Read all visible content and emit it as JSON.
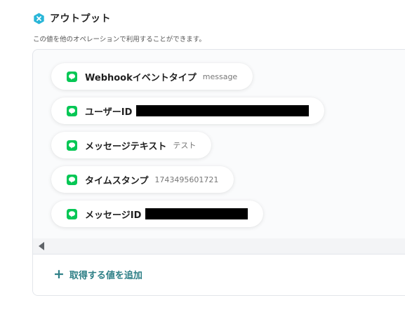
{
  "section": {
    "title": "アウトプット",
    "description": "この値を他のオペレーションで利用することができます。",
    "icon": "x-hexagon-icon",
    "icon_color": "#29b6d8"
  },
  "outputs": [
    {
      "label": "Webhookイベントタイプ",
      "value": "message",
      "icon": "line-app-icon",
      "redacted": false
    },
    {
      "label": "ユーザーID",
      "value": "",
      "icon": "line-app-icon",
      "redacted": true
    },
    {
      "label": "メッセージテキスト",
      "value": "テスト",
      "icon": "line-app-icon",
      "redacted": false
    },
    {
      "label": "タイムスタンプ",
      "value": "1743495601721",
      "icon": "line-app-icon",
      "redacted": false
    },
    {
      "label": "メッセージID",
      "value": "",
      "icon": "line-app-icon",
      "redacted": true
    }
  ],
  "footer": {
    "add_label": "取得する値を追加",
    "add_icon": "plus-icon",
    "accent": "#2d7f86"
  },
  "line_icon_color": "#06c755"
}
